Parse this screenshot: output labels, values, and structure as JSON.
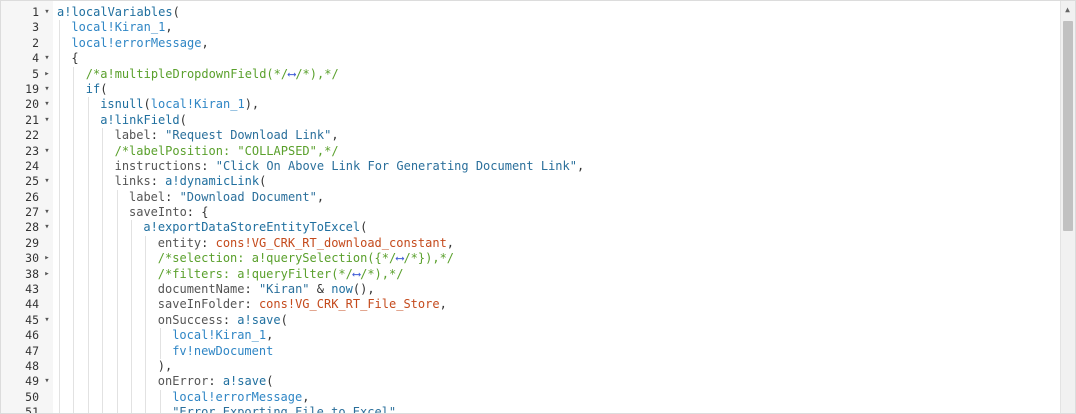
{
  "editor": {
    "lines": [
      {
        "n": "1",
        "f": "▾",
        "indent": 0,
        "toks": [
          [
            "fn",
            "a!localVariables"
          ],
          [
            "p",
            "("
          ]
        ]
      },
      {
        "n": "3",
        "f": "",
        "indent": 1,
        "toks": [
          [
            "var",
            "local!Kiran_1"
          ],
          [
            "p",
            ","
          ]
        ]
      },
      {
        "n": "2",
        "f": "",
        "indent": 1,
        "toks": [
          [
            "var",
            "local!errorMessage"
          ],
          [
            "p",
            ","
          ]
        ]
      },
      {
        "n": "4",
        "f": "▾",
        "indent": 1,
        "toks": [
          [
            "p",
            "{"
          ]
        ]
      },
      {
        "n": "5",
        "f": "▸",
        "indent": 2,
        "toks": [
          [
            "cmt",
            "/*a!multipleDropdownField(*/"
          ],
          [
            "arrow",
            "⟷"
          ],
          [
            "cmt",
            "/*),*/"
          ]
        ]
      },
      {
        "n": "19",
        "f": "▾",
        "indent": 2,
        "toks": [
          [
            "fn",
            "if"
          ],
          [
            "p",
            "("
          ]
        ]
      },
      {
        "n": "20",
        "f": "▾",
        "indent": 3,
        "toks": [
          [
            "fn",
            "isnull"
          ],
          [
            "p",
            "("
          ],
          [
            "var",
            "local!Kiran_1"
          ],
          [
            "p",
            "),"
          ]
        ]
      },
      {
        "n": "21",
        "f": "▾",
        "indent": 3,
        "toks": [
          [
            "fn",
            "a!linkField"
          ],
          [
            "p",
            "("
          ]
        ]
      },
      {
        "n": "22",
        "f": "",
        "indent": 4,
        "toks": [
          [
            "key",
            "label"
          ],
          [
            "p",
            ": "
          ],
          [
            "str",
            "\"Request Download Link\""
          ],
          [
            "p",
            ","
          ]
        ]
      },
      {
        "n": "23",
        "f": "▾",
        "indent": 4,
        "toks": [
          [
            "cmt",
            "/*labelPosition: \"COLLAPSED\",*/"
          ]
        ]
      },
      {
        "n": "24",
        "f": "",
        "indent": 4,
        "toks": [
          [
            "key",
            "instructions"
          ],
          [
            "p",
            ": "
          ],
          [
            "str",
            "\"Click On Above Link For Generating Document Link\""
          ],
          [
            "p",
            ","
          ]
        ]
      },
      {
        "n": "25",
        "f": "▾",
        "indent": 4,
        "toks": [
          [
            "key",
            "links"
          ],
          [
            "p",
            ": "
          ],
          [
            "fn",
            "a!dynamicLink"
          ],
          [
            "p",
            "("
          ]
        ]
      },
      {
        "n": "26",
        "f": "",
        "indent": 5,
        "toks": [
          [
            "key",
            "label"
          ],
          [
            "p",
            ": "
          ],
          [
            "str",
            "\"Download Document\""
          ],
          [
            "p",
            ","
          ]
        ]
      },
      {
        "n": "27",
        "f": "▾",
        "indent": 5,
        "toks": [
          [
            "key",
            "saveInto"
          ],
          [
            "p",
            ": {"
          ]
        ]
      },
      {
        "n": "28",
        "f": "▾",
        "indent": 6,
        "toks": [
          [
            "fn",
            "a!exportDataStoreEntityToExcel"
          ],
          [
            "p",
            "("
          ]
        ]
      },
      {
        "n": "29",
        "f": "",
        "indent": 7,
        "toks": [
          [
            "key",
            "entity"
          ],
          [
            "p",
            ": "
          ],
          [
            "const",
            "cons!VG_CRK_RT_download_constant"
          ],
          [
            "p",
            ","
          ]
        ]
      },
      {
        "n": "30",
        "f": "▸",
        "indent": 7,
        "toks": [
          [
            "cmt",
            "/*selection: a!querySelection({*/"
          ],
          [
            "arrow",
            "⟷"
          ],
          [
            "cmt",
            "/*}),*/"
          ]
        ]
      },
      {
        "n": "38",
        "f": "▸",
        "indent": 7,
        "toks": [
          [
            "cmt",
            "/*filters: a!queryFilter(*/"
          ],
          [
            "arrow",
            "⟷"
          ],
          [
            "cmt",
            "/*),*/"
          ]
        ]
      },
      {
        "n": "43",
        "f": "",
        "indent": 7,
        "toks": [
          [
            "key",
            "documentName"
          ],
          [
            "p",
            ": "
          ],
          [
            "str",
            "\"Kiran\""
          ],
          [
            "p",
            " & "
          ],
          [
            "fn",
            "now"
          ],
          [
            "p",
            "(),"
          ]
        ]
      },
      {
        "n": "44",
        "f": "",
        "indent": 7,
        "toks": [
          [
            "key",
            "saveInFolder"
          ],
          [
            "p",
            ": "
          ],
          [
            "const",
            "cons!VG_CRK_RT_File_Store"
          ],
          [
            "p",
            ","
          ]
        ]
      },
      {
        "n": "45",
        "f": "▾",
        "indent": 7,
        "toks": [
          [
            "key",
            "onSuccess"
          ],
          [
            "p",
            ": "
          ],
          [
            "fn",
            "a!save"
          ],
          [
            "p",
            "("
          ]
        ]
      },
      {
        "n": "46",
        "f": "",
        "indent": 8,
        "toks": [
          [
            "var",
            "local!Kiran_1"
          ],
          [
            "p",
            ","
          ]
        ]
      },
      {
        "n": "47",
        "f": "",
        "indent": 8,
        "toks": [
          [
            "var",
            "fv!newDocument"
          ]
        ]
      },
      {
        "n": "48",
        "f": "",
        "indent": 7,
        "toks": [
          [
            "p",
            "),"
          ]
        ]
      },
      {
        "n": "49",
        "f": "▾",
        "indent": 7,
        "toks": [
          [
            "key",
            "onError"
          ],
          [
            "p",
            ": "
          ],
          [
            "fn",
            "a!save"
          ],
          [
            "p",
            "("
          ]
        ]
      },
      {
        "n": "50",
        "f": "",
        "indent": 8,
        "toks": [
          [
            "var",
            "local!errorMessage"
          ],
          [
            "p",
            ","
          ]
        ]
      },
      {
        "n": "51",
        "f": "",
        "indent": 8,
        "toks": [
          [
            "str",
            "\"Error Exporting File to Excel\""
          ]
        ]
      }
    ]
  },
  "scrollbar": {
    "up_arrow": "▲",
    "thumb_fraction": 0.5
  },
  "colors": {
    "function": "#1f6f9f",
    "variable": "#2f86c5",
    "comment": "#5aa02c",
    "constant": "#c44a1c"
  }
}
